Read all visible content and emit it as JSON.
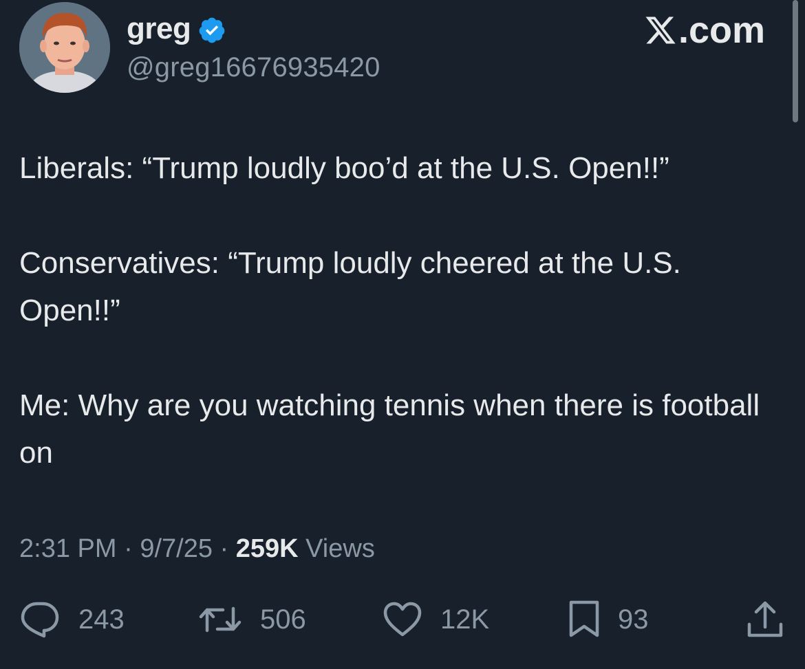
{
  "author": {
    "display_name": "greg",
    "handle": "@greg16676935420",
    "verified": true
  },
  "site_logo_text": ".com",
  "tweet": {
    "paragraphs": [
      "Liberals: “Trump loudly boo’d at the U.S. Open!!”",
      "Conservatives: “Trump loudly cheered at the U.S. Open!!”",
      "Me: Why are you watching tennis when there is football on"
    ]
  },
  "meta": {
    "time": "2:31 PM",
    "separator": " · ",
    "date": "9/7/25",
    "views_count": "259K",
    "views_label": " Views"
  },
  "actions": {
    "replies": "243",
    "reposts": "506",
    "likes": "12K",
    "bookmarks": "93"
  },
  "colors": {
    "background": "#17202b",
    "text_primary": "#e7e9ea",
    "text_secondary": "#8b98a5",
    "verified_blue": "#1d9bf0"
  },
  "icons": [
    "verified-badge-icon",
    "x-logo-icon",
    "reply-icon",
    "repost-icon",
    "like-icon",
    "bookmark-icon",
    "share-icon"
  ]
}
